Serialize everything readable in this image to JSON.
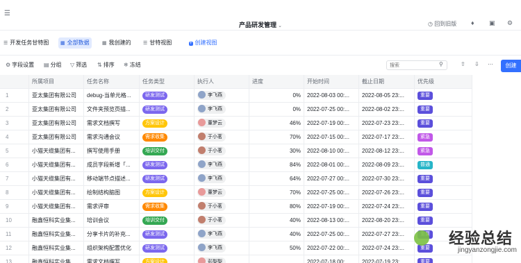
{
  "header": {
    "title": "产品研发管理",
    "back_label": "回到旧版"
  },
  "tabs": [
    {
      "label": "开发任务甘特图",
      "icon": "gantt-icon"
    },
    {
      "label": "全部数据",
      "icon": "grid-icon",
      "active": true
    },
    {
      "label": "我创建的",
      "icon": "table-icon"
    },
    {
      "label": "甘特视图",
      "icon": "gantt-icon"
    },
    {
      "label": "创建视图",
      "icon": "plus-icon"
    }
  ],
  "toolbar": {
    "field_settings": "字段设置",
    "group": "分组",
    "filter": "筛选",
    "sort": "排序",
    "freeze": "冻结",
    "search_placeholder": "搜索",
    "create_label": "创建"
  },
  "columns": [
    "所属项目",
    "任务名称",
    "任务类型",
    "执行人",
    "进度",
    "开始时间",
    "截止日期",
    "优先级"
  ],
  "rows": [
    {
      "no": "1",
      "project": "亚太集团有限公司",
      "task": "debug-当单元格...",
      "type": "研发测试",
      "user": "李飞燕",
      "progress": "0%",
      "start": "2022-08-03 00:...",
      "end": "2022-08-05 23:...",
      "priority": "重要"
    },
    {
      "no": "2",
      "project": "亚太集团有限公司",
      "task": "文件夹预览页描...",
      "type": "研发测试",
      "user": "李飞燕",
      "progress": "0%",
      "start": "2022-07-25 00:...",
      "end": "2022-08-02 23:...",
      "priority": "重要"
    },
    {
      "no": "3",
      "project": "亚太集团有限公司",
      "task": "需求文档撰写",
      "type": "方案设计",
      "user": "董梦云",
      "progress": "46%",
      "start": "2022-07-19 00:...",
      "end": "2022-07-23 23:...",
      "priority": "重要"
    },
    {
      "no": "4",
      "project": "亚太集团有限公司",
      "task": "需求沟通会议",
      "type": "需求收集",
      "user": "于小茗",
      "progress": "70%",
      "start": "2022-07-15 00:...",
      "end": "2022-07-17 23:...",
      "priority": "紧急"
    },
    {
      "no": "5",
      "project": "小猫天缆集团有...",
      "task": "撰写使用手册",
      "type": "培训交付",
      "user": "于小茗",
      "progress": "30%",
      "start": "2022-08-10 00:...",
      "end": "2022-08-12 23:...",
      "priority": "紧急"
    },
    {
      "no": "6",
      "project": "小猫天缆集团有...",
      "task": "成员字段新增「...",
      "type": "研发测试",
      "user": "李飞燕",
      "progress": "84%",
      "start": "2022-08-01 00:...",
      "end": "2022-08-09 23:...",
      "priority": "普通"
    },
    {
      "no": "7",
      "project": "小猫天缆集团有...",
      "task": "移动端节点描述...",
      "type": "研发测试",
      "user": "李飞燕",
      "progress": "64%",
      "start": "2022-07-27 00:...",
      "end": "2022-07-30 23:...",
      "priority": "重要"
    },
    {
      "no": "8",
      "project": "小猫天缆集团有...",
      "task": "绘制结构脑图",
      "type": "方案设计",
      "user": "董梦云",
      "progress": "70%",
      "start": "2022-07-25 00:...",
      "end": "2022-07-26 23:...",
      "priority": "重要"
    },
    {
      "no": "9",
      "project": "小猫天缆集团有...",
      "task": "需求评审",
      "type": "需求收集",
      "user": "于小茗",
      "progress": "80%",
      "start": "2022-07-19 00:...",
      "end": "2022-07-24 23:...",
      "priority": "重要"
    },
    {
      "no": "10",
      "project": "融鑫恒科实业集...",
      "task": "培训会议",
      "type": "培训交付",
      "user": "于小茗",
      "progress": "40%",
      "start": "2022-08-13 00:...",
      "end": "2022-08-20 23:...",
      "priority": "重要"
    },
    {
      "no": "11",
      "project": "融鑫恒科实业集...",
      "task": "分享卡片的补充...",
      "type": "研发测试",
      "user": "李飞燕",
      "progress": "40%",
      "start": "2022-07-25 00:...",
      "end": "2022-07-27 23:...",
      "priority": "重要"
    },
    {
      "no": "12",
      "project": "融鑫恒科实业集...",
      "task": "组织架构配置优化",
      "type": "研发测试",
      "user": "李飞燕",
      "progress": "50%",
      "start": "2022-07-22 00:...",
      "end": "2022-07-24 23:...",
      "priority": "重要"
    },
    {
      "no": "13",
      "project": "融鑫恒科实业集...",
      "task": "需求文档撰写",
      "type": "方案设计",
      "user": "彭梨梨",
      "progress": "",
      "start": "2022-07-18 00:...",
      "end": "2022-07-19 23:...",
      "priority": "重要"
    }
  ],
  "watermark": {
    "text": "经验总结",
    "url": "jingyanzongjie.com"
  }
}
